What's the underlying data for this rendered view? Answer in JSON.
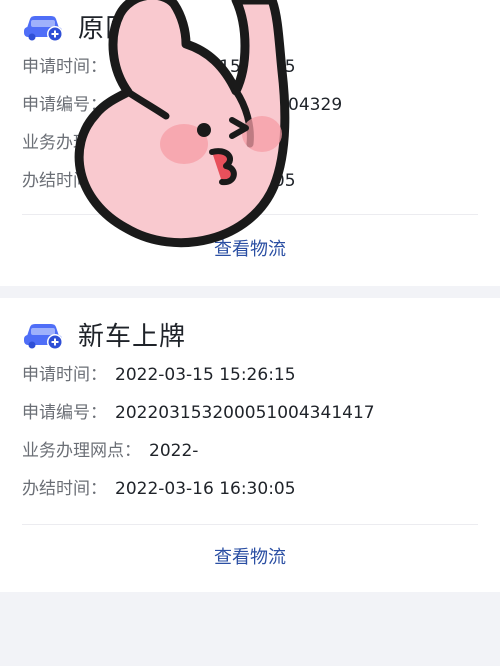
{
  "card1": {
    "title": "原区域",
    "rows": [
      {
        "label": "申请时间：",
        "value": "2022-03-15 15:11:35"
      },
      {
        "label": "申请编号：",
        "value": "202203151100051004329"
      },
      {
        "label": "业务办理网点：",
        "value": ""
      },
      {
        "label": "办结时间：",
        "value": "2022-03-16 16:30:05"
      }
    ],
    "logistics_label": "查看物流"
  },
  "card2": {
    "title": "新车上牌",
    "rows": [
      {
        "label": "申请时间：",
        "value": "2022-03-15 15:26:15"
      },
      {
        "label": "申请编号：",
        "value": "202203153200051004341417"
      },
      {
        "label": "业务办理网点：",
        "value": "2022-"
      },
      {
        "label": "办结时间：",
        "value": "2022-03-16 16:30:05"
      }
    ],
    "logistics_label": "查看物流"
  },
  "colors": {
    "accent": "#2b4fa3",
    "icon_blue": "#4f6ef7",
    "background": "#f2f3f7",
    "sticker_pink": "#f9c9cf"
  }
}
